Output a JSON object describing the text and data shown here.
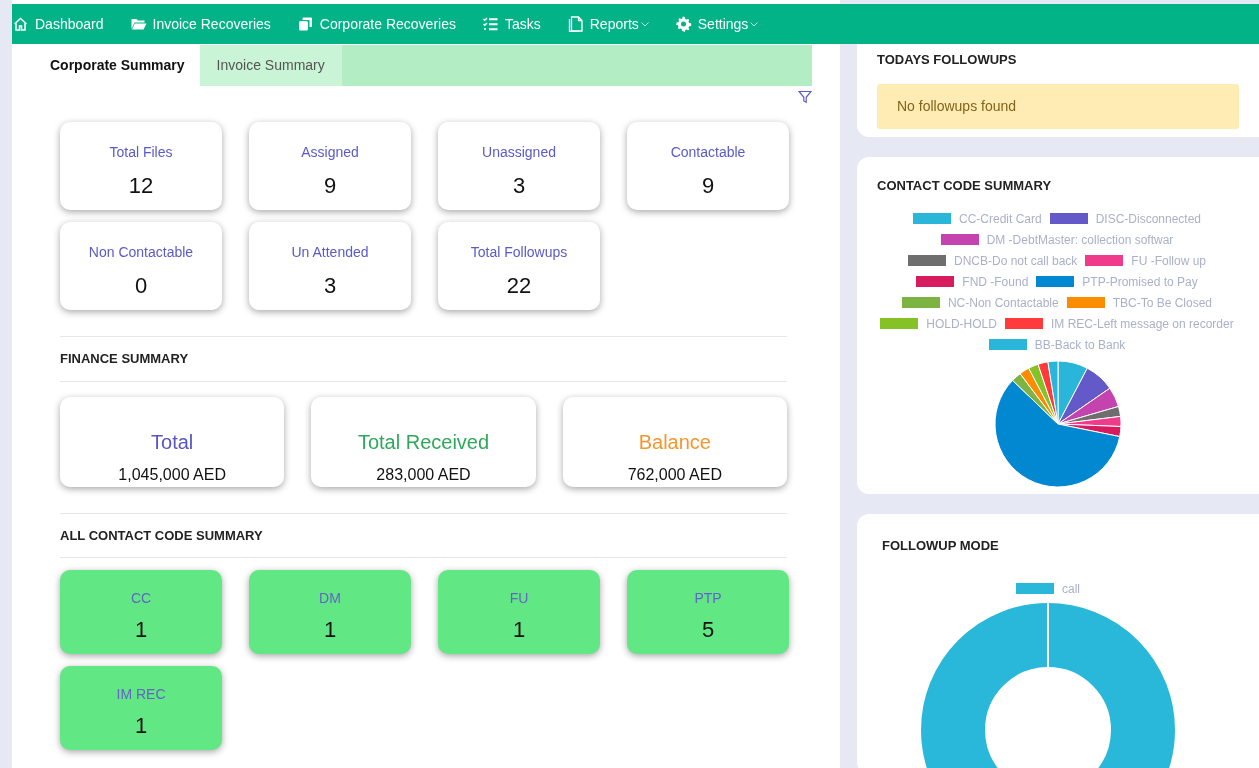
{
  "nav": {
    "items": [
      {
        "label": "Dashboard",
        "dropdown": false
      },
      {
        "label": "Invoice Recoveries",
        "dropdown": false
      },
      {
        "label": "Corporate Recoveries",
        "dropdown": false
      },
      {
        "label": "Tasks",
        "dropdown": false
      },
      {
        "label": "Reports",
        "dropdown": true
      },
      {
        "label": "Settings",
        "dropdown": true
      }
    ]
  },
  "tabs": [
    {
      "label": "Corporate Summary",
      "selected": true
    },
    {
      "label": "Invoice Summary",
      "selected": false
    }
  ],
  "stats": [
    {
      "label": "Total Files",
      "value": "12"
    },
    {
      "label": "Assigned",
      "value": "9"
    },
    {
      "label": "Unassigned",
      "value": "3"
    },
    {
      "label": "Contactable",
      "value": "9"
    },
    {
      "label": "Non Contactable",
      "value": "0"
    },
    {
      "label": "Un Attended",
      "value": "3"
    },
    {
      "label": "Total Followups",
      "value": "22"
    }
  ],
  "finance_summary": {
    "title": "FINANCE SUMMARY",
    "cards": [
      {
        "label": "Total",
        "value": "1,045,000 AED",
        "color": "#5a55c4"
      },
      {
        "label": "Total Received",
        "value": "283,000 AED",
        "color": "#2ea95c"
      },
      {
        "label": "Balance",
        "value": "762,000 AED",
        "color": "#f5962e"
      }
    ]
  },
  "contact_code_summary": {
    "title": "ALL CONTACT CODE SUMMARY",
    "cards": [
      {
        "label": "CC",
        "value": "1"
      },
      {
        "label": "DM",
        "value": "1"
      },
      {
        "label": "FU",
        "value": "1"
      },
      {
        "label": "PTP",
        "value": "5"
      },
      {
        "label": "IM REC",
        "value": "1"
      }
    ]
  },
  "todays_followups": {
    "title": "TODAYS FOLLOWUPS",
    "message": "No followups found"
  },
  "contact_code_chart": {
    "title": "CONTACT CODE SUMMARY",
    "legend": [
      {
        "label": "CC-Credit Card",
        "color": "#29b6d9"
      },
      {
        "label": "DISC-Disconnected",
        "color": "#6359c9"
      },
      {
        "label": "DM -DebtMaster: collection softwar",
        "color": "#c443ae"
      },
      {
        "label": "DNCB-Do not call back",
        "color": "#6e6e6e"
      },
      {
        "label": "FU -Follow up",
        "color": "#f03a8c"
      },
      {
        "label": "FND -Found",
        "color": "#d81b5e"
      },
      {
        "label": "PTP-Promised to Pay",
        "color": "#0288d1"
      },
      {
        "label": "NC-Non Contactable",
        "color": "#7cb342"
      },
      {
        "label": "TBC-To Be Closed",
        "color": "#fb8c00"
      },
      {
        "label": "HOLD-HOLD",
        "color": "#84c225"
      },
      {
        "label": "IM REC-Left message on recorder",
        "color": "#ff3b3b"
      },
      {
        "label": "BB-Back to Bank",
        "color": "#29b6d9"
      }
    ]
  },
  "followup_mode": {
    "title": "FOLLOWUP MODE",
    "legend": [
      {
        "label": "call",
        "color": "#29b8da"
      }
    ]
  }
}
